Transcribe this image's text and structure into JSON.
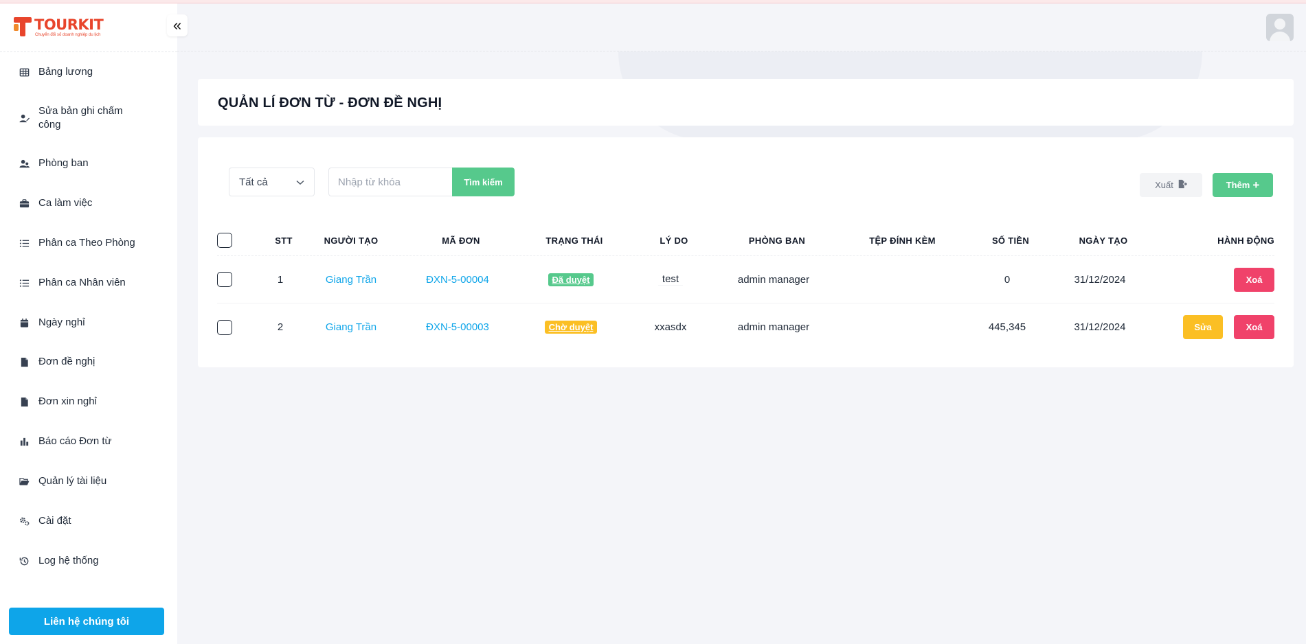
{
  "brand": {
    "name": "TOURKIT",
    "tagline": "Chuyển đổi số doanh nghiệp du lịch"
  },
  "sidebar": {
    "collapse_icon": "«",
    "items": [
      {
        "label": "Bảng lương",
        "icon": "table-icon"
      },
      {
        "label": "Sửa bản ghi chấm công",
        "icon": "user-edit-icon"
      },
      {
        "label": "Phòng ban",
        "icon": "users-icon"
      },
      {
        "label": "Ca làm việc",
        "icon": "briefcase-icon"
      },
      {
        "label": "Phân ca Theo Phòng",
        "icon": "list-icon"
      },
      {
        "label": "Phân ca Nhân viên",
        "icon": "list-icon"
      },
      {
        "label": "Ngày nghỉ",
        "icon": "calendar-icon"
      },
      {
        "label": "Đơn đề nghị",
        "icon": "file-icon"
      },
      {
        "label": "Đơn xin nghỉ",
        "icon": "file-icon"
      },
      {
        "label": "Báo cáo Đơn từ",
        "icon": "bar-chart-icon"
      },
      {
        "label": "Quản lý tài liệu",
        "icon": "folder-open-icon"
      },
      {
        "label": "Cài đặt",
        "icon": "gears-icon"
      },
      {
        "label": "Log hệ thống",
        "icon": "history-icon"
      }
    ],
    "contact_label": "Liên hệ chúng tôi"
  },
  "page": {
    "title": "QUẢN LÍ ĐƠN TỪ - ĐƠN ĐỀ NGHỊ"
  },
  "filters": {
    "status_selected": "Tất cả",
    "search_placeholder": "Nhập từ khóa",
    "search_label": "Tìm kiếm",
    "export_label": "Xuất",
    "add_label": "Thêm",
    "add_icon": "+"
  },
  "table": {
    "headers": {
      "stt": "STT",
      "creator": "NGƯỜI TẠO",
      "code": "MÃ ĐƠN",
      "status": "TRẠNG THÁI",
      "reason": "LÝ DO",
      "department": "PHÒNG BAN",
      "attachment": "TỆP ĐÍNH KÈM",
      "amount": "SỐ TIỀN",
      "created": "NGÀY TẠO",
      "actions": "HÀNH ĐỘNG"
    },
    "rows": [
      {
        "stt": "1",
        "creator": "Giang Trần",
        "code": "ĐXN-5-00004",
        "status": "Đã duyệt",
        "status_color": "#56c98c",
        "reason": "test",
        "department": "admin manager",
        "attachment": "",
        "amount": "0",
        "created": "31/12/2024",
        "edit_label": "",
        "delete_label": "Xoá"
      },
      {
        "stt": "2",
        "creator": "Giang Trần",
        "code": "ĐXN-5-00003",
        "status": "Chờ duyệt",
        "status_color": "#fbbf24",
        "reason": "xxasdx",
        "department": "admin manager",
        "attachment": "",
        "amount": "445,345",
        "created": "31/12/2024",
        "edit_label": "Sửa",
        "delete_label": "Xoá"
      }
    ]
  }
}
